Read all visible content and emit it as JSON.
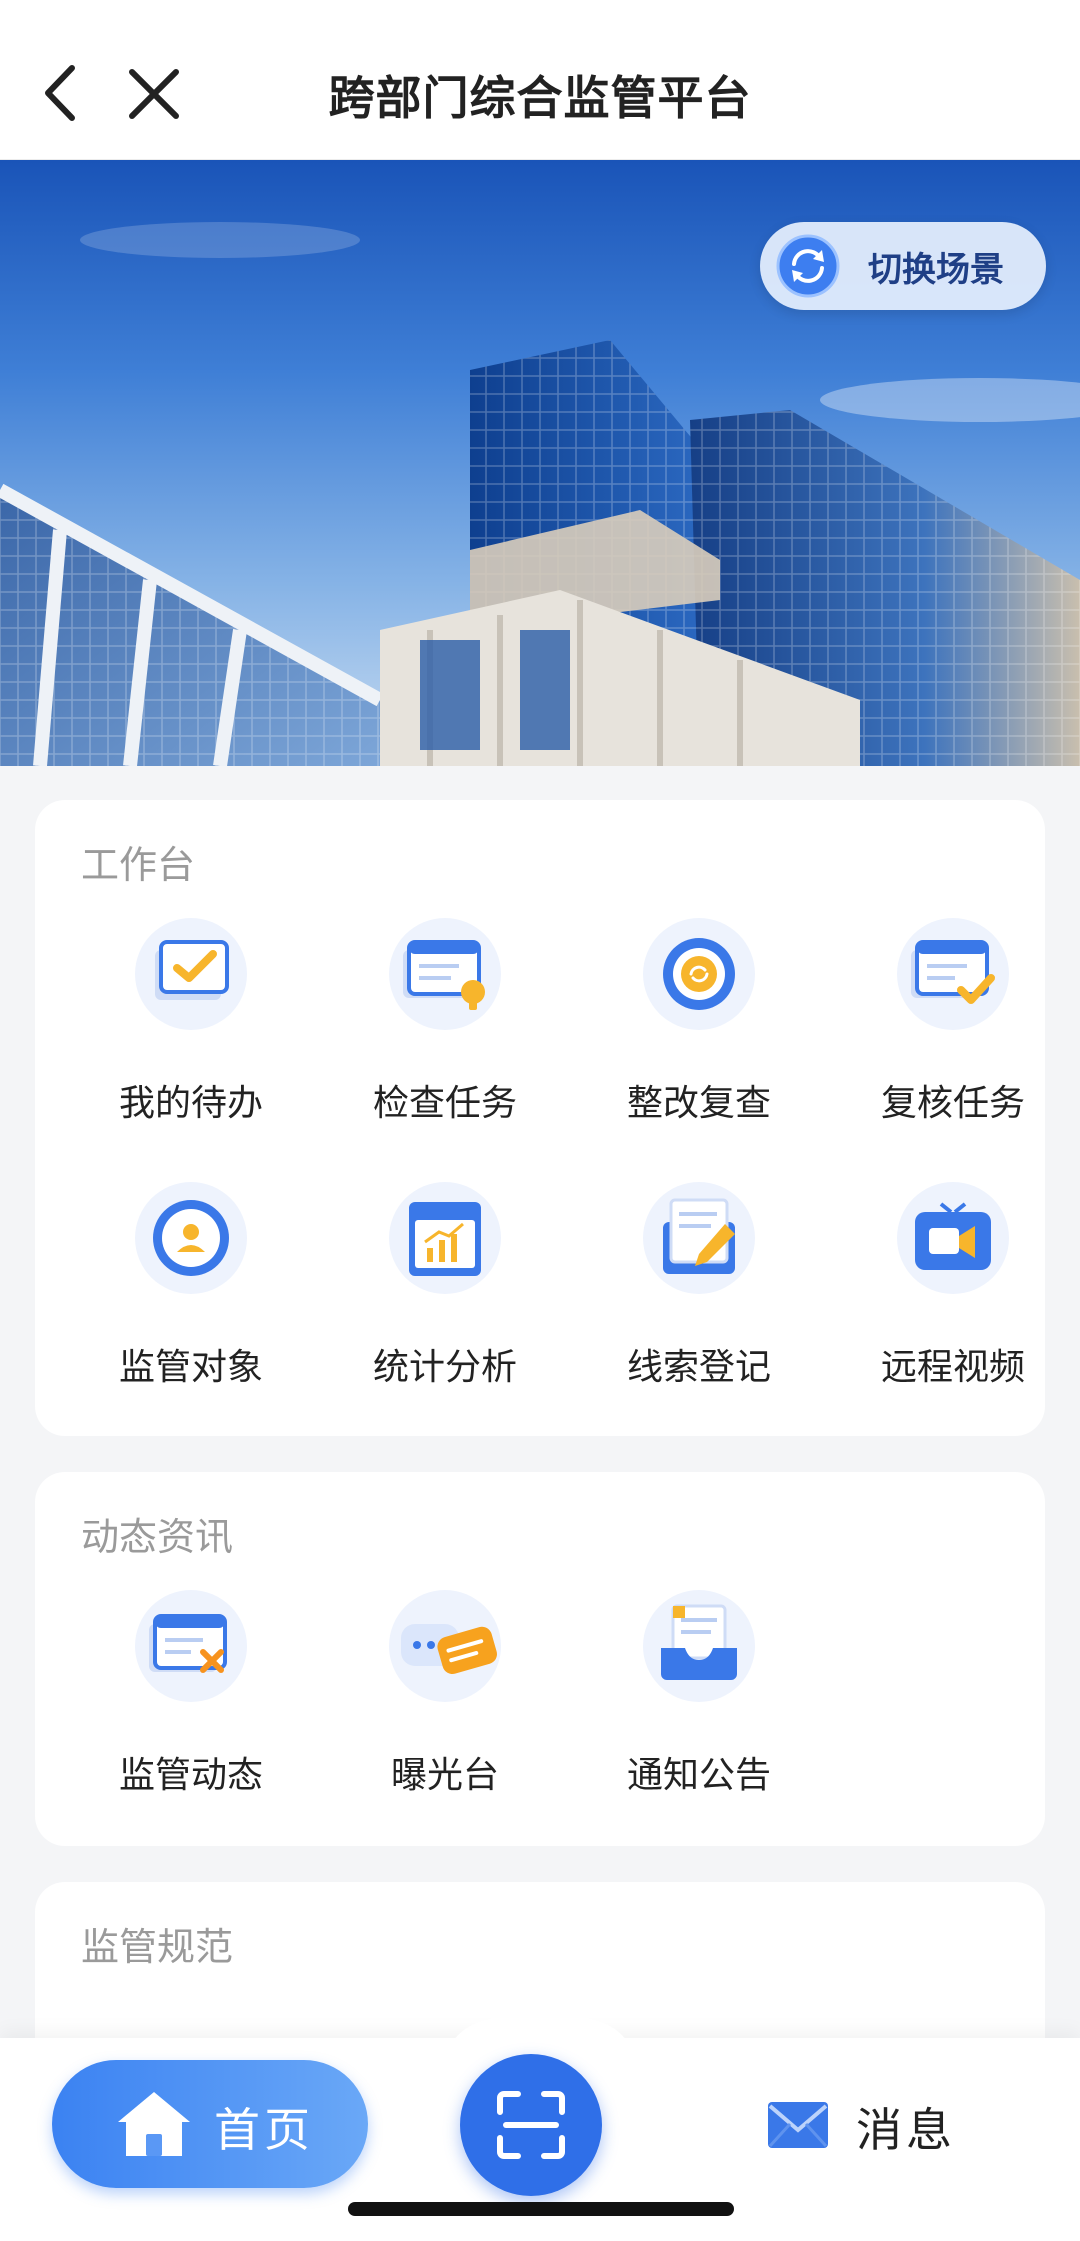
{
  "header": {
    "title": "跨部门综合监管平台"
  },
  "banner": {
    "switch_label": "切换场景"
  },
  "workbench": {
    "title": "工作台",
    "items": [
      {
        "label": "我的待办",
        "icon": "todo-check-icon"
      },
      {
        "label": "检查任务",
        "icon": "inspection-task-icon"
      },
      {
        "label": "整改复查",
        "icon": "rectify-review-icon"
      },
      {
        "label": "复核任务",
        "icon": "recheck-task-icon"
      },
      {
        "label": "监管对象",
        "icon": "supervised-object-icon"
      },
      {
        "label": "统计分析",
        "icon": "statistics-chart-icon"
      },
      {
        "label": "线索登记",
        "icon": "clue-register-icon"
      },
      {
        "label": "远程视频",
        "icon": "remote-video-icon"
      }
    ]
  },
  "news": {
    "title": "动态资讯",
    "items": [
      {
        "label": "监管动态",
        "icon": "supervision-news-icon"
      },
      {
        "label": "曝光台",
        "icon": "exposure-chat-icon"
      },
      {
        "label": "通知公告",
        "icon": "notice-inbox-icon"
      }
    ]
  },
  "norms": {
    "title": "监管规范"
  },
  "tabbar": {
    "home_label": "首页",
    "message_label": "消息"
  },
  "colors": {
    "primary": "#2f6fe8",
    "accent": "#f7b52c",
    "text": "#222222",
    "muted": "#9a9a9a"
  }
}
